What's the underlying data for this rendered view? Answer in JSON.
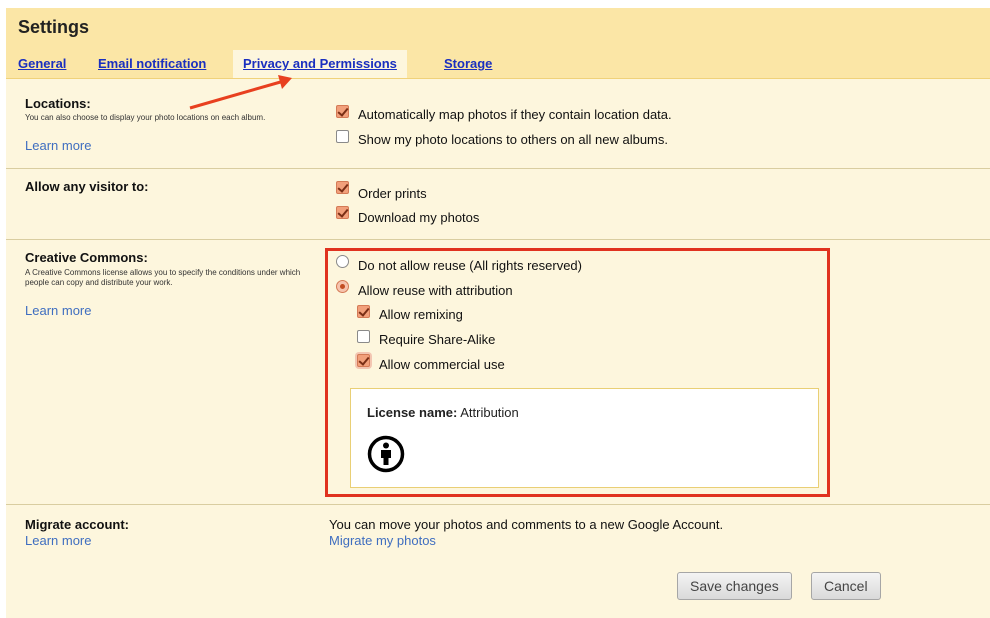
{
  "header": {
    "title": "Settings"
  },
  "tabs": [
    {
      "label": "General"
    },
    {
      "label": "Email notification"
    },
    {
      "label": "Privacy and Permissions"
    },
    {
      "label": "Storage"
    }
  ],
  "locations": {
    "title": "Locations:",
    "desc": "You can also choose to display your photo locations on each album.",
    "learn_more": "Learn more",
    "options": [
      {
        "label": "Automatically map photos if they contain location data.",
        "checked": true
      },
      {
        "label": "Show my photo locations to others on all new albums.",
        "checked": false
      }
    ]
  },
  "visitor": {
    "title": "Allow any visitor to:",
    "options": [
      {
        "label": "Order prints",
        "checked": true
      },
      {
        "label": "Download my photos",
        "checked": true
      }
    ]
  },
  "creative_commons": {
    "title": "Creative Commons:",
    "desc": "A Creative Commons license allows you to specify the conditions under which people can copy and distribute your work.",
    "learn_more": "Learn more",
    "radios": [
      {
        "label": "Do not allow reuse (All rights reserved)",
        "checked": false
      },
      {
        "label": "Allow reuse with attribution",
        "checked": true
      }
    ],
    "sub_options": [
      {
        "label": "Allow remixing",
        "checked": true
      },
      {
        "label": "Require Share-Alike",
        "checked": false
      },
      {
        "label": "Allow commercial use",
        "checked": true
      }
    ],
    "license_label": "License name:",
    "license_value": "Attribution",
    "license_icon": "attribution-icon"
  },
  "migrate": {
    "title": "Migrate account:",
    "learn_more": "Learn more",
    "text": "You can move your photos and comments to a new Google Account.",
    "link": "Migrate my photos"
  },
  "footer": {
    "save": "Save changes",
    "cancel": "Cancel"
  },
  "colors": {
    "header_bg": "#fbe6a6",
    "body_bg": "#fdf6dd",
    "link": "#3f6ec0",
    "tab_link": "#1a2fbf",
    "highlight_border": "#e0321f",
    "arrow": "#e8401f"
  }
}
